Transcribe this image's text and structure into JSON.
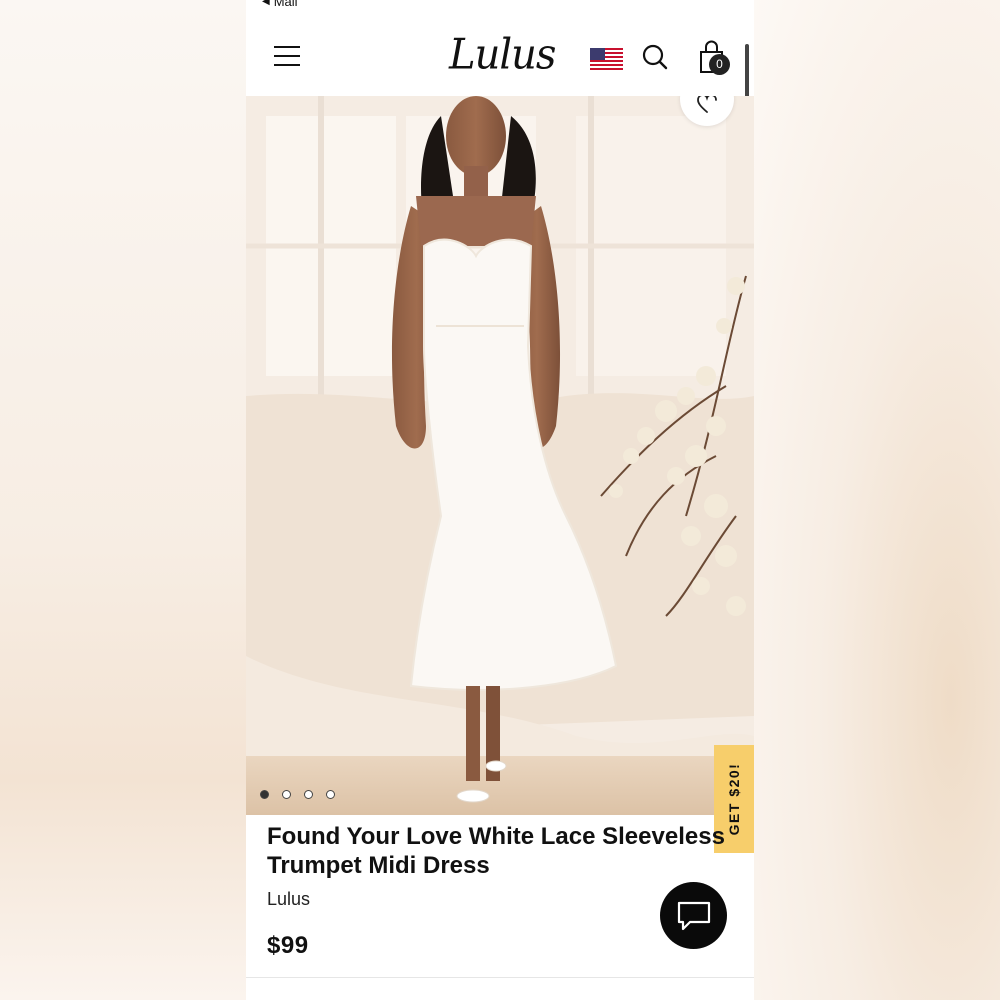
{
  "status_bar": {
    "back_label": "Mail"
  },
  "header": {
    "logo": "Lulus",
    "cart_count": "0"
  },
  "icons": {
    "menu": "hamburger-icon",
    "flag": "us-flag-icon",
    "search": "search-icon",
    "cart": "shopping-bag-icon",
    "wishlist": "heart-icon",
    "chat": "chat-icon"
  },
  "carousel": {
    "count": 4,
    "active_index": 0
  },
  "promo": {
    "label": "GET $20!"
  },
  "product": {
    "title_line1": "Found Your Love White Lace Sleeveless",
    "title_line2": "Trumpet Midi Dress",
    "brand": "Lulus",
    "price": "$99"
  },
  "colors": {
    "promo": "#f7ce6b",
    "chat_button": "#0a0a0a",
    "text": "#111111"
  }
}
